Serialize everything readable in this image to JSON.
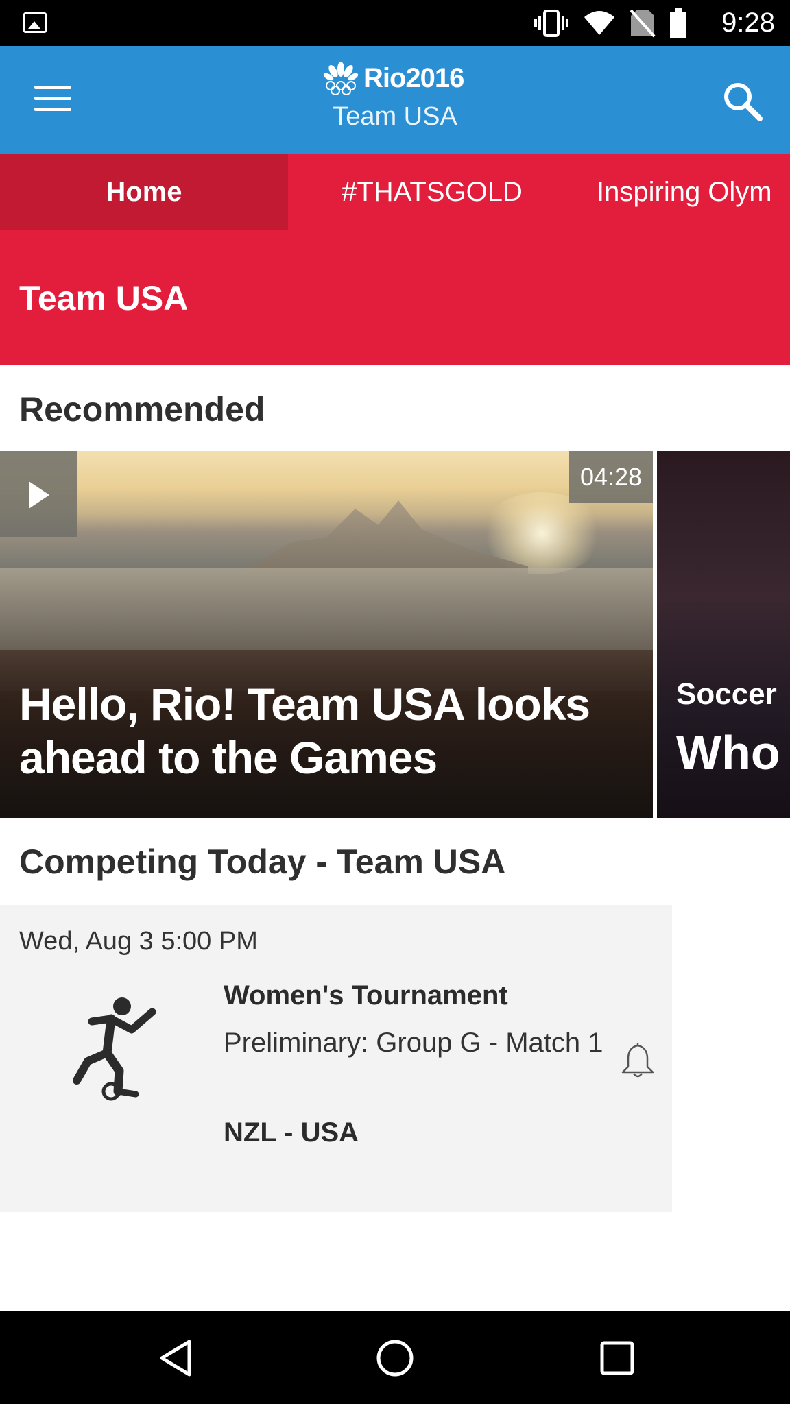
{
  "status_bar": {
    "time": "9:28",
    "icons": [
      "image-notification-icon",
      "vibrate-icon",
      "wifi-icon",
      "no-sim-icon",
      "battery-icon"
    ]
  },
  "app_bar": {
    "logo_text": "Rio2016",
    "subtitle": "Team USA",
    "icons": [
      "menu-icon",
      "nbc-peacock-icon",
      "search-icon"
    ]
  },
  "tabs": [
    {
      "label": "Home",
      "active": true
    },
    {
      "label": "#THATSGOLD",
      "active": false
    },
    {
      "label": "Inspiring Olym",
      "active": false
    }
  ],
  "page_header": {
    "title": "Team USA"
  },
  "recommended": {
    "section_title": "Recommended",
    "cards": [
      {
        "duration": "04:28",
        "title": "Hello, Rio! Team USA looks ahead to the Games",
        "icon": "play-icon"
      },
      {
        "category": "Soccer",
        "title": "Who"
      }
    ]
  },
  "competing": {
    "section_title": "Competing Today - Team USA",
    "events": [
      {
        "date": "Wed, Aug 3 5:00 PM",
        "sport_icon": "soccer-player-icon",
        "title": "Women's Tournament",
        "round": "Preliminary: Group G - Match 1",
        "match": "NZL - USA",
        "alert_icon": "bell-icon"
      }
    ]
  },
  "nav_bar": {
    "icons": [
      "back-icon",
      "home-icon",
      "recents-icon"
    ]
  },
  "colors": {
    "app_bar": "#2b8fd3",
    "tab_bar": "#e31d3c",
    "tab_active": "#c11a32",
    "event_card": "#f3f3f3"
  }
}
